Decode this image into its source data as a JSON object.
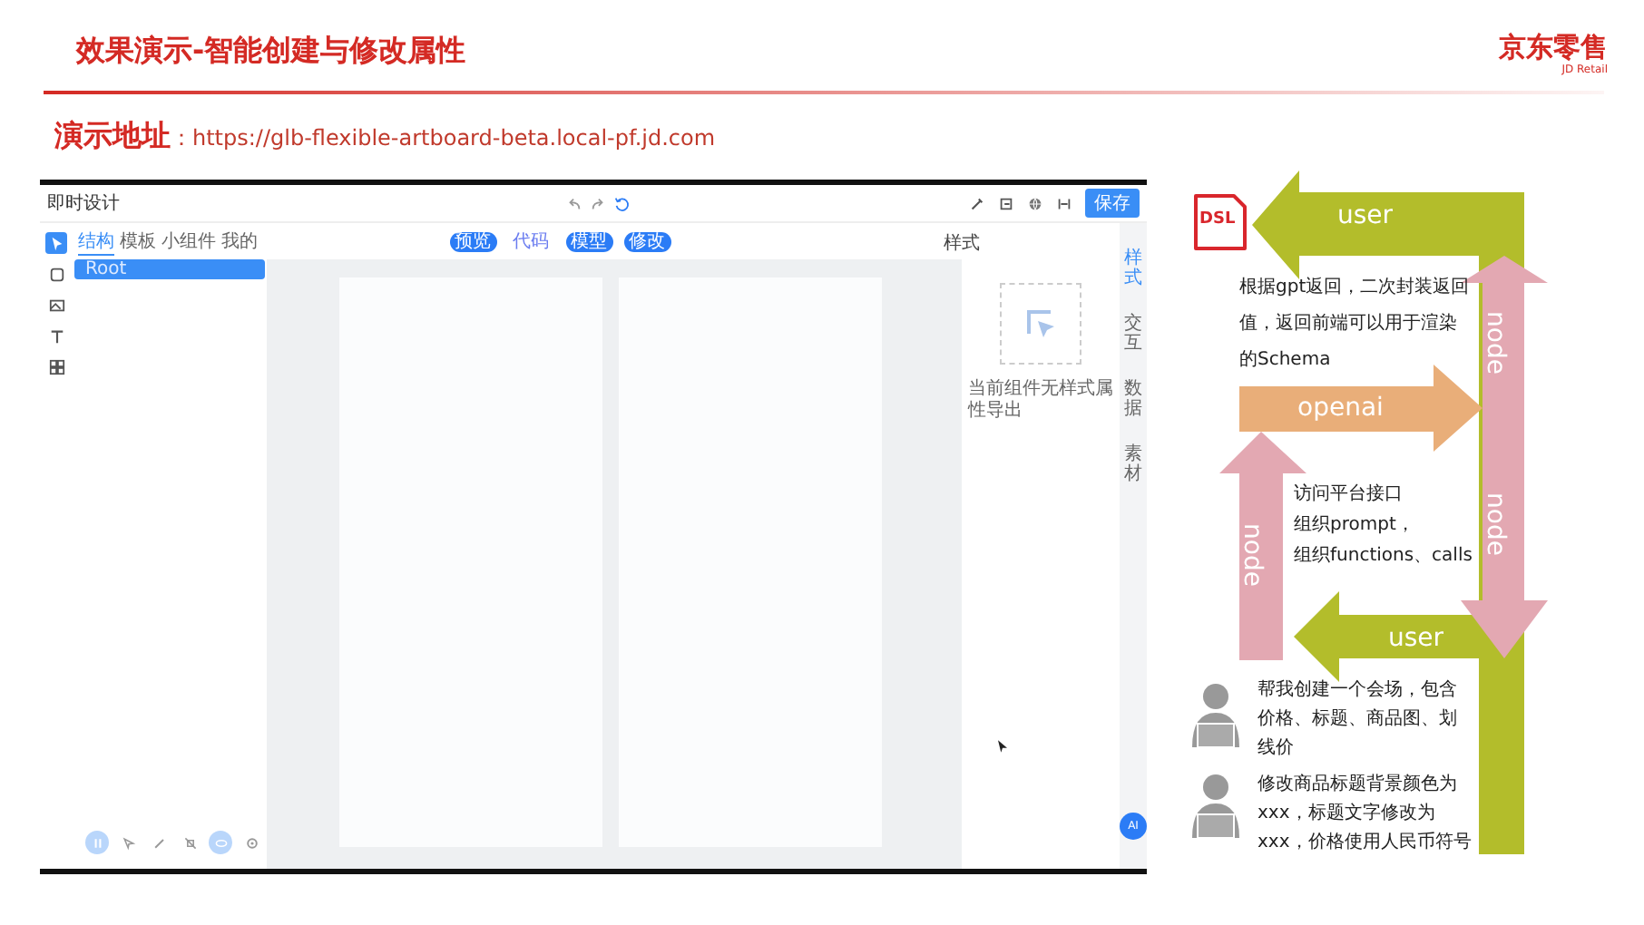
{
  "slide": {
    "title": "效果演示-智能创建与修改属性",
    "logo": "京东零售",
    "logo_sub": "JD Retail",
    "address_label": "演示地址",
    "address_url": "：https://glb-flexible-artboard-beta.local-pf.jd.com"
  },
  "app": {
    "title": "即时设计",
    "save": "保存",
    "rail": [
      {
        "kind": "cursor",
        "selected": true
      },
      {
        "kind": "square",
        "selected": false
      },
      {
        "kind": "image",
        "selected": false
      },
      {
        "kind": "text",
        "selected": false
      },
      {
        "kind": "grid",
        "selected": false
      }
    ],
    "tabs": [
      {
        "label": "结构",
        "selected": true
      },
      {
        "label": "模板",
        "selected": false
      },
      {
        "label": "小组件",
        "selected": false
      },
      {
        "label": "我的",
        "selected": false
      }
    ],
    "tree": [
      {
        "label": "Root",
        "selected": true
      }
    ],
    "toolbar": [
      {
        "kind": "pause",
        "selected": true
      },
      {
        "kind": "pointer",
        "selected": false
      },
      {
        "kind": "pen",
        "selected": false
      },
      {
        "kind": "mute",
        "selected": false
      },
      {
        "kind": "eye",
        "selected": true
      },
      {
        "kind": "target",
        "selected": false
      }
    ],
    "chips": [
      {
        "label": "预览",
        "selected": true
      },
      {
        "label": "代码",
        "selected": false
      },
      {
        "label": "模型",
        "selected": true
      },
      {
        "label": "修改",
        "selected": true
      }
    ],
    "panel_title": "样式",
    "empty_text": "当前组件无样式属性导出",
    "side_tabs": [
      {
        "label": "样式",
        "selected": true
      },
      {
        "label": "交互",
        "selected": false
      },
      {
        "label": "数据",
        "selected": false
      },
      {
        "label": "素材",
        "selected": false
      }
    ],
    "ai_button": "AI"
  },
  "diagram": {
    "dsl": "DSL",
    "user_top": "user",
    "node_upper": "node",
    "node_lower": "node",
    "node_left": "node",
    "openai": "openai",
    "user_bottom": "user",
    "note_return": "根据gpt返回，二次封装返回值，返回前端可以用于渲染的Schema",
    "note_openai": [
      "访问平台接口",
      "组织prompt，",
      "组织functions、calls"
    ],
    "requests": [
      "帮我创建一个会场，包含价格、标题、商品图、划线价",
      "修改商品标题背景颜色为xxx，标题文字修改为xxx，价格使用人民币符号"
    ]
  }
}
